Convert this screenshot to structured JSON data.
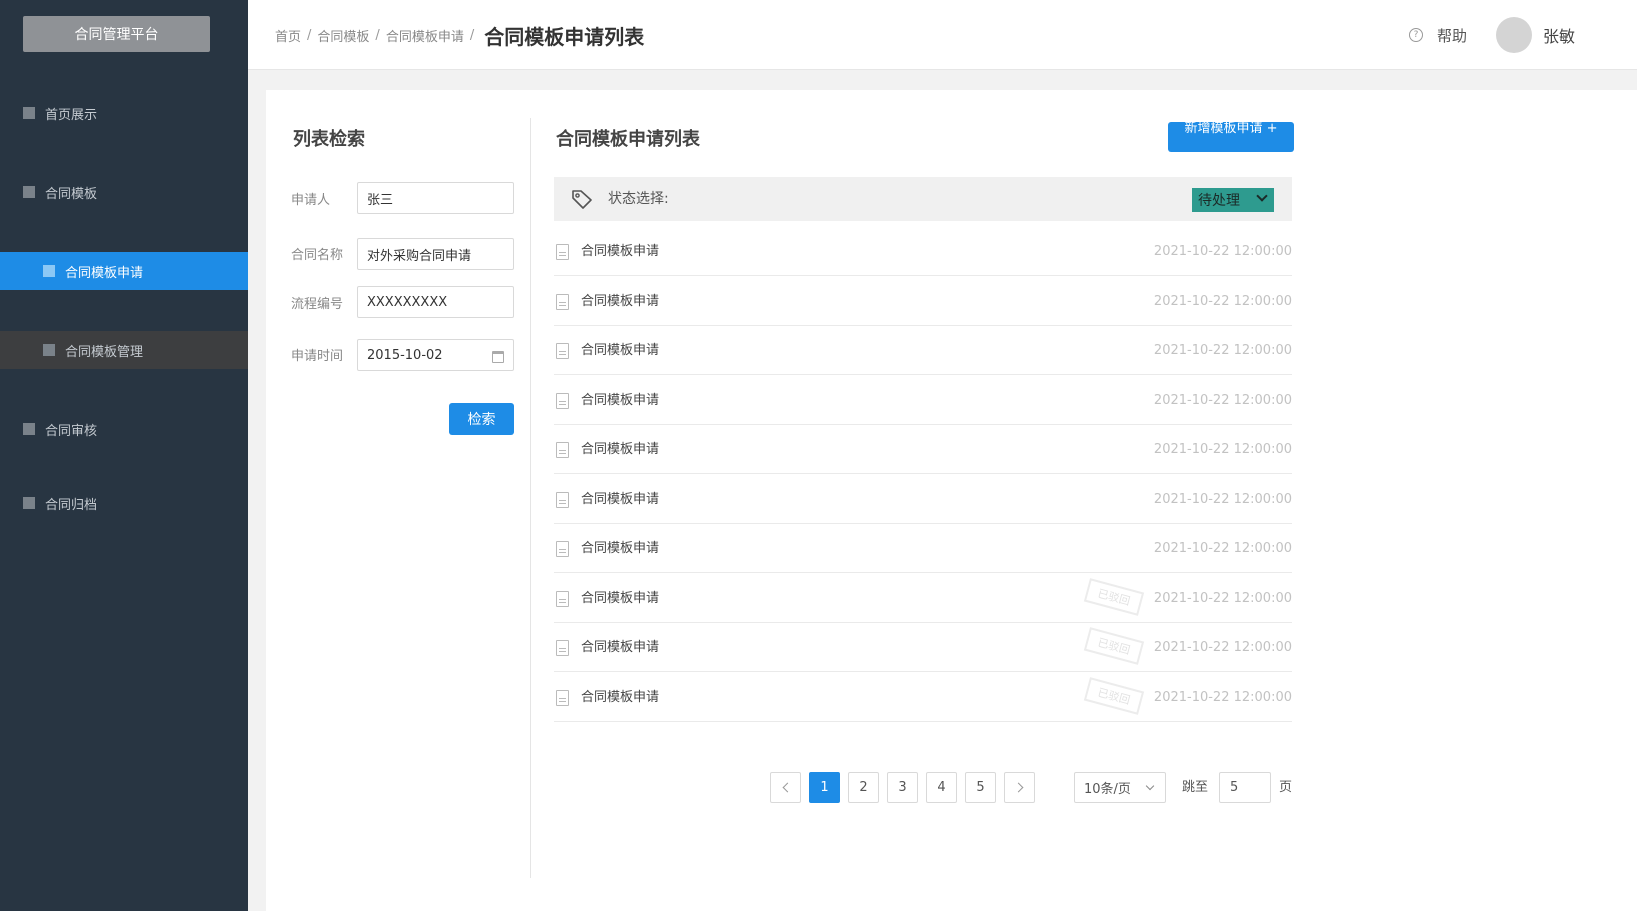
{
  "sidebar": {
    "logo": "合同管理平台",
    "items": [
      {
        "label": "首页展示"
      },
      {
        "label": "合同模板"
      },
      {
        "label": "合同模板申请"
      },
      {
        "label": "合同模板管理"
      },
      {
        "label": "合同审核"
      },
      {
        "label": "合同归档"
      }
    ]
  },
  "header": {
    "breadcrumb": [
      "首页",
      "合同模板",
      "合同模板申请"
    ],
    "current": "合同模板申请列表",
    "help": "帮助",
    "user_name": "张敏"
  },
  "filter": {
    "title": "列表检索",
    "fields": [
      {
        "label": "申请人",
        "value": "张三"
      },
      {
        "label": "合同名称",
        "value": "对外采购合同申请"
      },
      {
        "label": "流程编号",
        "value": "XXXXXXXXX"
      },
      {
        "label": "申请时间",
        "value": "2015-10-02"
      }
    ],
    "search_button": "检索"
  },
  "list": {
    "title": "合同模板申请列表",
    "add_button": "新增模板申请 +",
    "status_label": "状态选择:",
    "status_value": "待处理",
    "rows": [
      {
        "name": "合同模板申请",
        "time": "2021-10-22 12:00:00",
        "stamp": ""
      },
      {
        "name": "合同模板申请",
        "time": "2021-10-22 12:00:00",
        "stamp": ""
      },
      {
        "name": "合同模板申请",
        "time": "2021-10-22 12:00:00",
        "stamp": ""
      },
      {
        "name": "合同模板申请",
        "time": "2021-10-22 12:00:00",
        "stamp": ""
      },
      {
        "name": "合同模板申请",
        "time": "2021-10-22 12:00:00",
        "stamp": ""
      },
      {
        "name": "合同模板申请",
        "time": "2021-10-22 12:00:00",
        "stamp": ""
      },
      {
        "name": "合同模板申请",
        "time": "2021-10-22 12:00:00",
        "stamp": ""
      },
      {
        "name": "合同模板申请",
        "time": "2021-10-22 12:00:00",
        "stamp": "已驳回"
      },
      {
        "name": "合同模板申请",
        "time": "2021-10-22 12:00:00",
        "stamp": "已驳回"
      },
      {
        "name": "合同模板申请",
        "time": "2021-10-22 12:00:00",
        "stamp": "已驳回"
      }
    ]
  },
  "pagination": {
    "pages": [
      "1",
      "2",
      "3",
      "4",
      "5"
    ],
    "current_page": "1",
    "page_size": "10条/页",
    "jump_label": "跳至",
    "jump_value": "5",
    "page_unit": "页"
  },
  "colors": {
    "sidebar_bg": "#283542",
    "accent": "#1e8ce6",
    "status_select_bg": "#2e9b8f"
  }
}
